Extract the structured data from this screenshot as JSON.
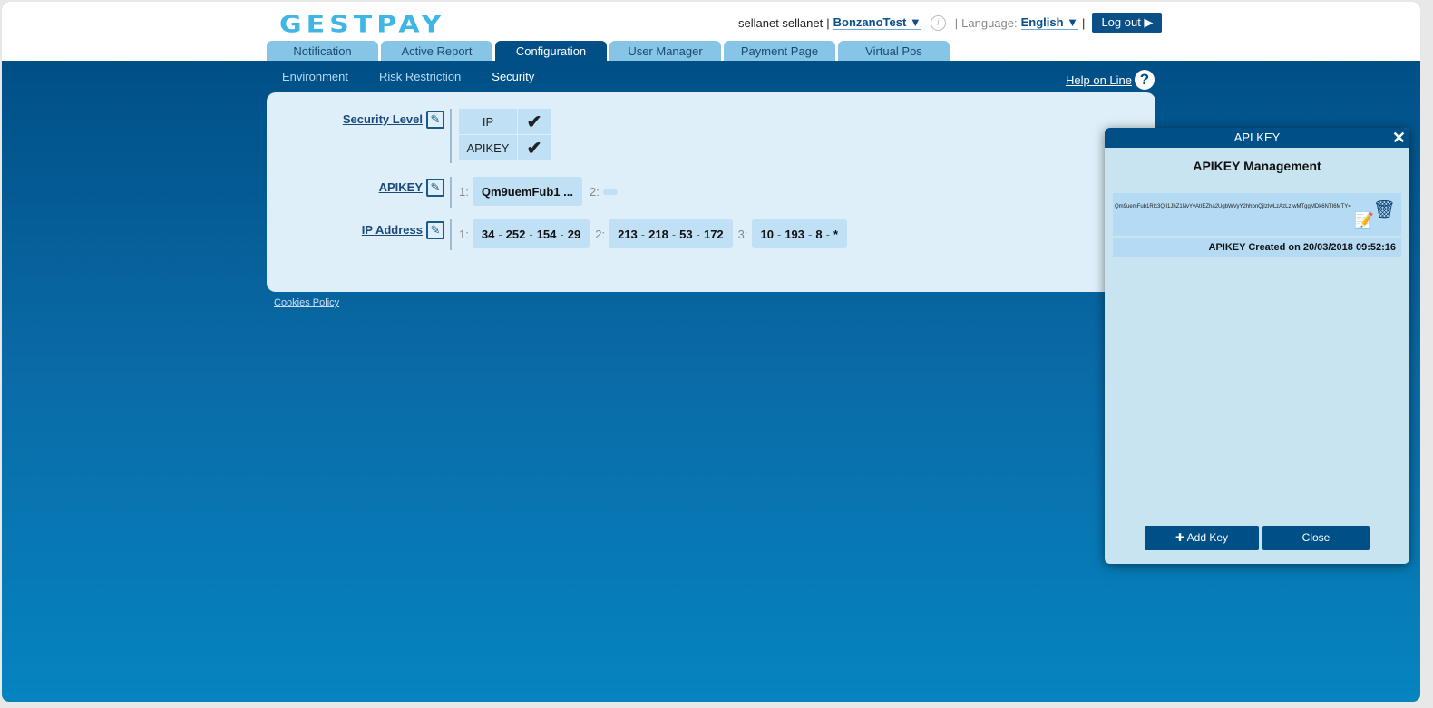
{
  "header": {
    "logo": "GESTPAY",
    "user": "sellanet sellanet",
    "merchant": "BonzanoTest",
    "language_label": "Language:",
    "language": "English",
    "logout": "Log out"
  },
  "tabs": [
    "Notification",
    "Active Report",
    "Configuration",
    "User Manager",
    "Payment Page",
    "Virtual Pos"
  ],
  "active_tab": "Configuration",
  "subnav": [
    "Environment",
    "Risk Restriction",
    "Security"
  ],
  "help": "Help on Line",
  "security": {
    "level_label": "Security Level",
    "levels": [
      "IP",
      "APIKEY"
    ],
    "apikey_label": "APIKEY",
    "apikeys": [
      {
        "n": "1:",
        "v": "Qm9uemFub1 ..."
      },
      {
        "n": "2:",
        "v": ""
      }
    ],
    "ip_label": "IP Address",
    "ips": [
      {
        "n": "1:",
        "parts": [
          "34",
          "252",
          "154",
          "29"
        ]
      },
      {
        "n": "2:",
        "parts": [
          "213",
          "218",
          "53",
          "172"
        ]
      },
      {
        "n": "3:",
        "parts": [
          "10",
          "193",
          "8",
          "*"
        ]
      }
    ]
  },
  "cookies": "Cookies Policy",
  "dialog": {
    "title": "API KEY",
    "heading": "APIKEY Management",
    "key": "Qm9uemFub1Rlc3QjI1JhZ1NvYyAtIEZha2UgbWVyY2hhbnQjIzIwLzAzLzIwMTggMDk6NTI6MTY=",
    "created": "APIKEY Created on 20/03/2018 09:52:16",
    "add": "Add Key",
    "close": "Close"
  }
}
